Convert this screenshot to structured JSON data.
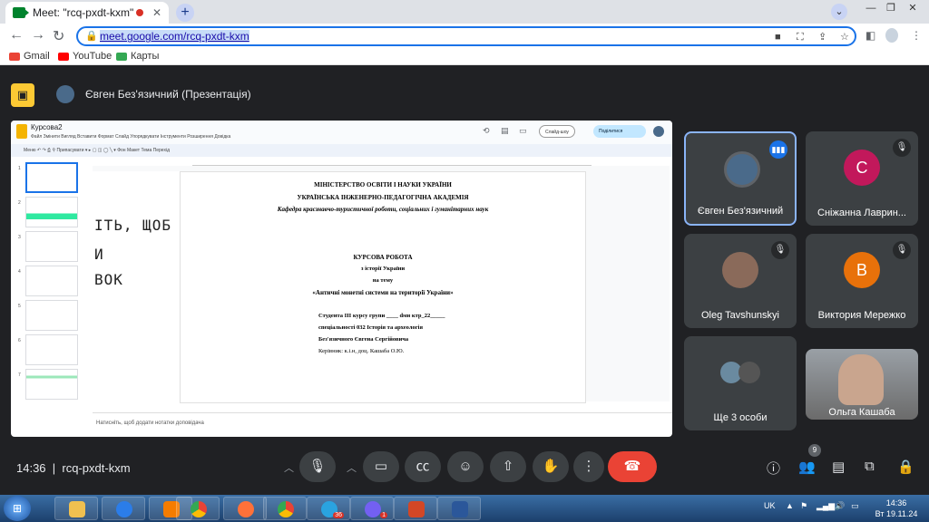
{
  "browser": {
    "tab_title": "Meet: \"rcq-pxdt-kxm\"",
    "close_glyph": "✕",
    "new_tab_glyph": "+",
    "url": "meet.google.com/rcq-pxdt-kxm",
    "bookmarks": [
      {
        "label": "Gmail",
        "color": "#ea4335"
      },
      {
        "label": "YouTube",
        "color": "#ff0000"
      },
      {
        "label": "Карты",
        "color": "#34a853"
      }
    ]
  },
  "meet": {
    "presenter_title": "Євген Без'язичний (Презентація)",
    "slides_doc": {
      "doc_title": "Курсова2",
      "menu": "Файл  Змінити  Вигляд  Вставити  Формат  Слайд  Упорядкувати  Інструменти  Розширення  Довідка",
      "slideshow_label": "Слайд-шоу",
      "share_label": "Поділитися",
      "tools": "Меню   ↶ ↷ ⎙ ⚲   Припасувати ▾   ▸ ▢ ◫ ◯ ╲ ▾   Фон   Макет   Тема   Перехід",
      "slide_numbers": [
        "1",
        "2",
        "3",
        "4",
        "5",
        "6",
        "7"
      ],
      "left_handwriting": [
        "ІТЬ, ЩОБ",
        "И",
        "ВОК"
      ],
      "lines": {
        "l1": "МІНІСТЕРСТВО ОСВІТИ І НАУКИ УКРАЇНИ",
        "l2": "УКРАЇНСЬКА ІНЖЕНЕРНО-ПЕДАГОГІЧНА АКАДЕМІЯ",
        "l3": "Кафедра краєзнавчо-туристичної роботи, соціальних і гуманітарних наук",
        "l4": "КУРСОВА РОБОТА",
        "l5": "з історії України",
        "l6": "на тему",
        "l7": "«Античні монетні системи на території України»",
        "d1": "Студента ІІІ курсу групи ____ dмн ктр_22_____",
        "d2": "спеціальності 032 Історія та археологія",
        "d3": "Без'язичного Євгена Сергійовича",
        "d4": "Керівник: к.і.н, доц. Кашаба О.Ю."
      },
      "notes_placeholder": "Натисніть, щоб додати нотатки доповідача"
    },
    "participants": [
      {
        "name": "Євген Без'язичний",
        "avatar": "",
        "color": "#4a6a8a",
        "speaking": true
      },
      {
        "name": "Сніжанна Лаврин...",
        "avatar": "С",
        "color": "#c2185b",
        "muted": true
      },
      {
        "name": "Oleg Tavshunskyi",
        "avatar": "",
        "color": "#8a6a5a",
        "muted": true
      },
      {
        "name": "Виктория Мережко",
        "avatar": "В",
        "color": "#e8710a",
        "muted": true
      },
      {
        "name": "Ще 3 особи"
      },
      {
        "name": "Ольга Кашаба"
      }
    ],
    "bottom": {
      "time": "14:36",
      "separator": "|",
      "meeting_code": "rcq-pxdt-kxm",
      "people_count": "9"
    }
  },
  "taskbar": {
    "viber_badge": "1",
    "telegram_badge": "36",
    "lang": "UK",
    "clock_time": "14:36",
    "clock_date": "Вт 19.11.24"
  }
}
